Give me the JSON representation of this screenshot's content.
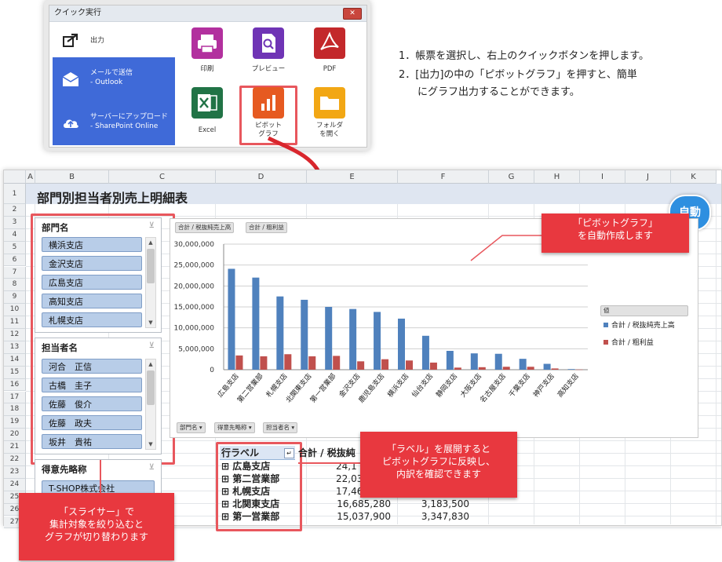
{
  "dialog": {
    "title": "クイック実行",
    "close_label": "✕",
    "side_items": [
      {
        "label": "出力",
        "sub": "",
        "icon": "export-icon"
      },
      {
        "label": "メールで送信",
        "sub": "- Outlook",
        "icon": "mail-icon"
      },
      {
        "label": "サーバーにアップロード",
        "sub": "- SharePoint Online",
        "icon": "cloud-upload-icon"
      }
    ],
    "tiles": [
      {
        "label1": "印刷",
        "label2": "",
        "color": "#b2309e",
        "icon": "printer-icon"
      },
      {
        "label1": "プレビュー",
        "label2": "",
        "color": "#6f34b5",
        "icon": "preview-icon"
      },
      {
        "label1": "PDF",
        "label2": "",
        "color": "#c3282b",
        "icon": "pdf-icon"
      },
      {
        "label1": "Excel",
        "label2": "",
        "color": "#217346",
        "icon": "excel-icon"
      },
      {
        "label1": "ピボット",
        "label2": "グラフ",
        "color": "#e65a21",
        "icon": "bar-chart-icon"
      },
      {
        "label1": "フォルダ",
        "label2": "を開く",
        "color": "#f2a714",
        "icon": "folder-icon"
      }
    ]
  },
  "instructions": {
    "step1": "1．帳票を選択し、右上のクイックボタンを押します。",
    "step2a": "2．[出力]の中の「ピボットグラフ」を押すと、簡単",
    "step2b": "にグラフ出力することができます。"
  },
  "sheet": {
    "columns": [
      "A",
      "B",
      "C",
      "D",
      "E",
      "F",
      "G",
      "H",
      "I",
      "J",
      "K"
    ],
    "rows": [
      "1",
      "2",
      "3",
      "4",
      "5",
      "6",
      "7",
      "8",
      "9",
      "10",
      "11",
      "12",
      "13",
      "14",
      "15",
      "16",
      "17",
      "18",
      "19",
      "20",
      "21",
      "22",
      "23",
      "24",
      "25",
      "26",
      "27"
    ],
    "title": "部門別担当者別売上明細表"
  },
  "slicers": {
    "department": {
      "title": "部門名",
      "items": [
        "横浜支店",
        "金沢支店",
        "広島支店",
        "高知支店",
        "札幌支店"
      ]
    },
    "person": {
      "title": "担当者名",
      "items": [
        "河合　正信",
        "古橋　圭子",
        "佐藤　俊介",
        "佐藤　政夫",
        "坂井　貴祐"
      ]
    },
    "customer": {
      "title": "得意先略称",
      "items": [
        "T-SHOP株式会社"
      ]
    }
  },
  "chart_field_buttons": {
    "top": [
      "合計 / 税抜純売上高",
      "合計 / 粗利益"
    ],
    "bottom": [
      "部門名 ▾",
      "得意先略称 ▾",
      "担当者名 ▾"
    ],
    "legend_title": "値"
  },
  "chart_data": {
    "type": "bar",
    "categories": [
      "広島支店",
      "第二営業部",
      "札幌支店",
      "北関東支店",
      "第一営業部",
      "金沢支店",
      "鹿児島支店",
      "横浜支店",
      "仙台支店",
      "静岡支店",
      "大阪支店",
      "名古屋支店",
      "千葉支店",
      "神戸支店",
      "高知支店"
    ],
    "series": [
      {
        "name": "合計 / 税抜純売上高",
        "color": "#4f81bd",
        "values": [
          24100000,
          22000000,
          17500000,
          16700000,
          15000000,
          14500000,
          13800000,
          12200000,
          8100000,
          4500000,
          3900000,
          3800000,
          2600000,
          1400000,
          150000
        ]
      },
      {
        "name": "合計 / 粗利益",
        "color": "#c0504d",
        "values": [
          3400000,
          3200000,
          3700000,
          3200000,
          3300000,
          2000000,
          2500000,
          2200000,
          1700000,
          500000,
          600000,
          700000,
          700000,
          300000,
          50000
        ]
      }
    ],
    "y_ticks": [
      "0",
      "5,000,000",
      "10,000,000",
      "15,000,000",
      "20,000,000",
      "25,000,000",
      "30,000,000"
    ],
    "ylim": [
      0,
      30000000
    ],
    "grid": true,
    "legend_position": "right"
  },
  "pivot": {
    "row_label_header": "行ラベル",
    "filter_glyph": "↵",
    "value_header": "合計 / 税抜純",
    "rows": [
      {
        "label": "⊞ 広島支店",
        "v1": "24,1",
        "v2": ""
      },
      {
        "label": "⊞ 第二営業部",
        "v1": "22,03",
        "v2": ""
      },
      {
        "label": "⊞ 札幌支店",
        "v1": "17,46",
        "v2": ""
      },
      {
        "label": "⊞ 北関東支店",
        "v1": "16,685,280",
        "v2": "3,183,500"
      },
      {
        "label": "⊞ 第一営業部",
        "v1": "15,037,900",
        "v2": "3,347,830"
      }
    ]
  },
  "callouts": {
    "pivot_graph_line1": "「ピボットグラフ」",
    "pivot_graph_line2": "を自動作成します",
    "label_line1": "「ラベル」を展開すると",
    "label_line2": "ピボットグラフに反映し、",
    "label_line3": "内訳を確認できます",
    "slicer_line1": "「スライサー」で",
    "slicer_line2": "集計対象を絞り込むと",
    "slicer_line3": "グラフが切り替わります",
    "auto_badge": "自動"
  },
  "colors": {
    "highlight": "#e8575d",
    "callout": "#e8383f",
    "accent_blue": "#3f6ad8"
  }
}
